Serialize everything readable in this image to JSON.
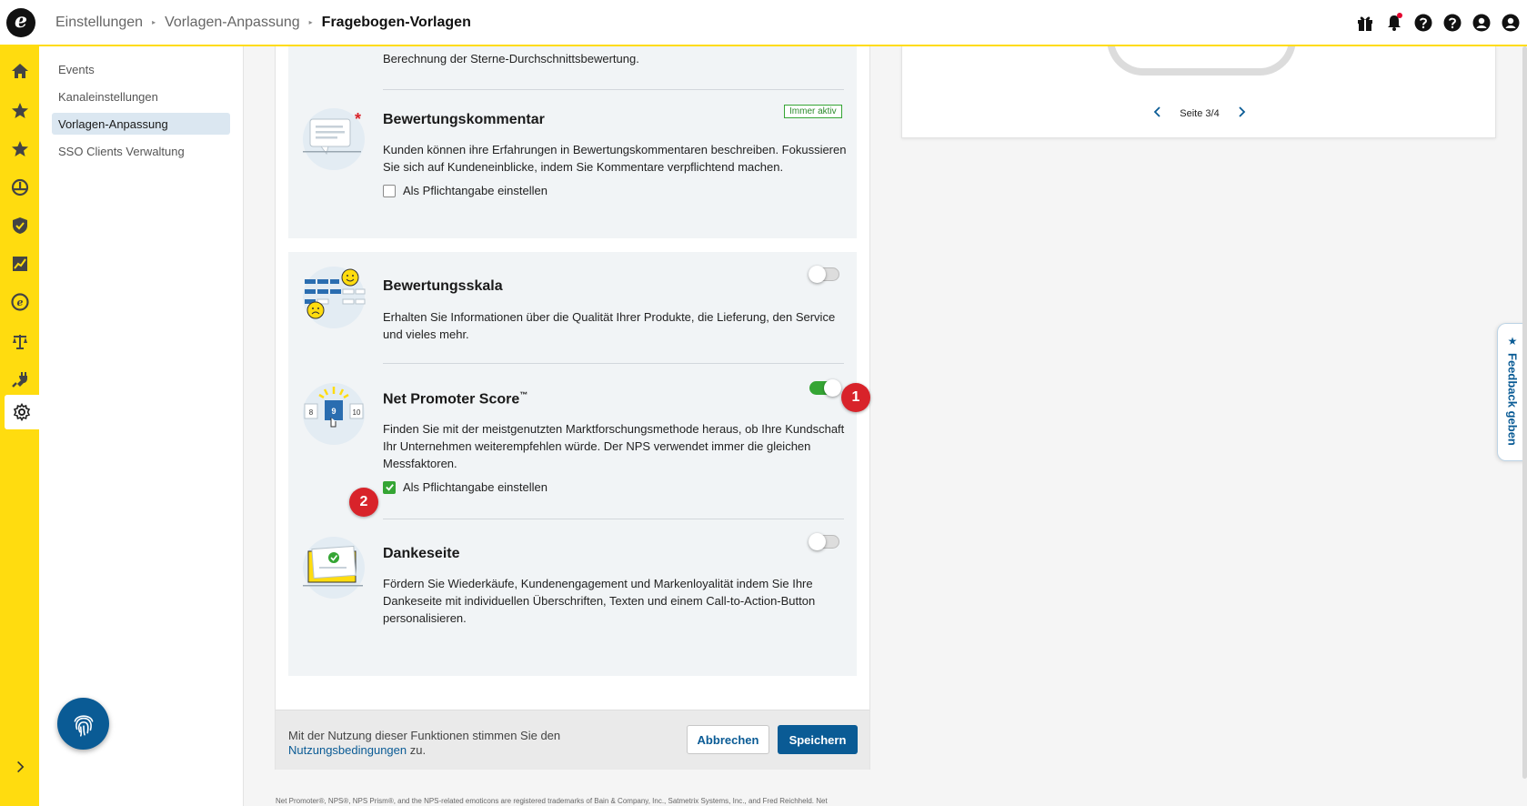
{
  "header": {
    "logo_letter": "e",
    "breadcrumbs": [
      "Einstellungen",
      "Vorlagen-Anpassung"
    ],
    "current_page": "Fragebogen-Vorlagen",
    "icons": [
      "gift-icon",
      "bell-icon",
      "help-icon",
      "help-icon",
      "account-icon",
      "user-icon"
    ]
  },
  "rail": {
    "icons": [
      "home-icon",
      "star-icon",
      "star-icon",
      "dashboard-icon",
      "shield-icon",
      "chart-icon",
      "e-coin-icon",
      "scale-icon",
      "plug-icon",
      "gear-icon"
    ],
    "active": "gear-icon"
  },
  "sidebar": {
    "items": [
      {
        "label": "Events"
      },
      {
        "label": "Kanaleinstellungen"
      },
      {
        "label": "Vorlagen-Anpassung"
      },
      {
        "label": "SSO Clients Verwaltung"
      }
    ],
    "active_index": 2
  },
  "content": {
    "top_fragment": "Berechnung der Sterne-Durchschnittsbewertung.",
    "bewertungskommentar": {
      "title": "Bewertungskommentar",
      "badge": "Immer aktiv",
      "description": "Kunden können ihre Erfahrungen in Bewertungskommentaren beschreiben. Fokussieren Sie sich auf Kundeneinblicke, indem Sie Kommentare verpflichtend machen.",
      "checkbox_label": "Als Pflichtangabe einstellen",
      "checked": false
    },
    "bewertungsskala": {
      "title": "Bewertungsskala",
      "description": "Erhalten Sie Informationen über die Qualität Ihrer Produkte, die Lieferung, den Service und vieles mehr.",
      "enabled": false
    },
    "nps": {
      "title": "Net Promoter Score",
      "title_mark": "™",
      "description": "Finden Sie mit der meistgenutzten Marktforschungsmethode heraus, ob Ihre Kundschaft Ihr Unternehmen weiterempfehlen würde. Der NPS verwendet immer die gleichen Messfaktoren.",
      "checkbox_label": "Als Pflichtangabe einstellen",
      "checked": true,
      "enabled": true,
      "scale_numbers": [
        "8",
        "9",
        "10"
      ]
    },
    "dankeseite": {
      "title": "Dankeseite",
      "description": "Fördern Sie Wiederkäufe, Kundenengagement und Markenloyalität indem Sie Ihre Dankeseite mit individuellen Überschriften, Texten und einem Call-to-Action-Button personalisieren.",
      "enabled": false
    },
    "markers": [
      "1",
      "2"
    ]
  },
  "footer": {
    "terms_prefix": "Mit der Nutzung dieser Funktionen stimmen Sie den ",
    "terms_link": "Nutzungsbedingungen",
    "terms_suffix": " zu.",
    "cancel_label": "Abbrechen",
    "save_label": "Speichern",
    "trademark": "Net Promoter®, NPS®, NPS Prism®, and the NPS-related emoticons are registered trademarks of Bain & Company, Inc., Satmetrix Systems, Inc., and Fred Reichheld. Net"
  },
  "preview": {
    "page_label": "Seite 3/4"
  },
  "feedback": {
    "label": "Feedback geben",
    "star": "★"
  },
  "colors": {
    "accent_yellow": "#ffdc0f",
    "brand_blue": "#0a5b95",
    "toggle_green": "#35a534",
    "marker_red": "#d8232a"
  }
}
